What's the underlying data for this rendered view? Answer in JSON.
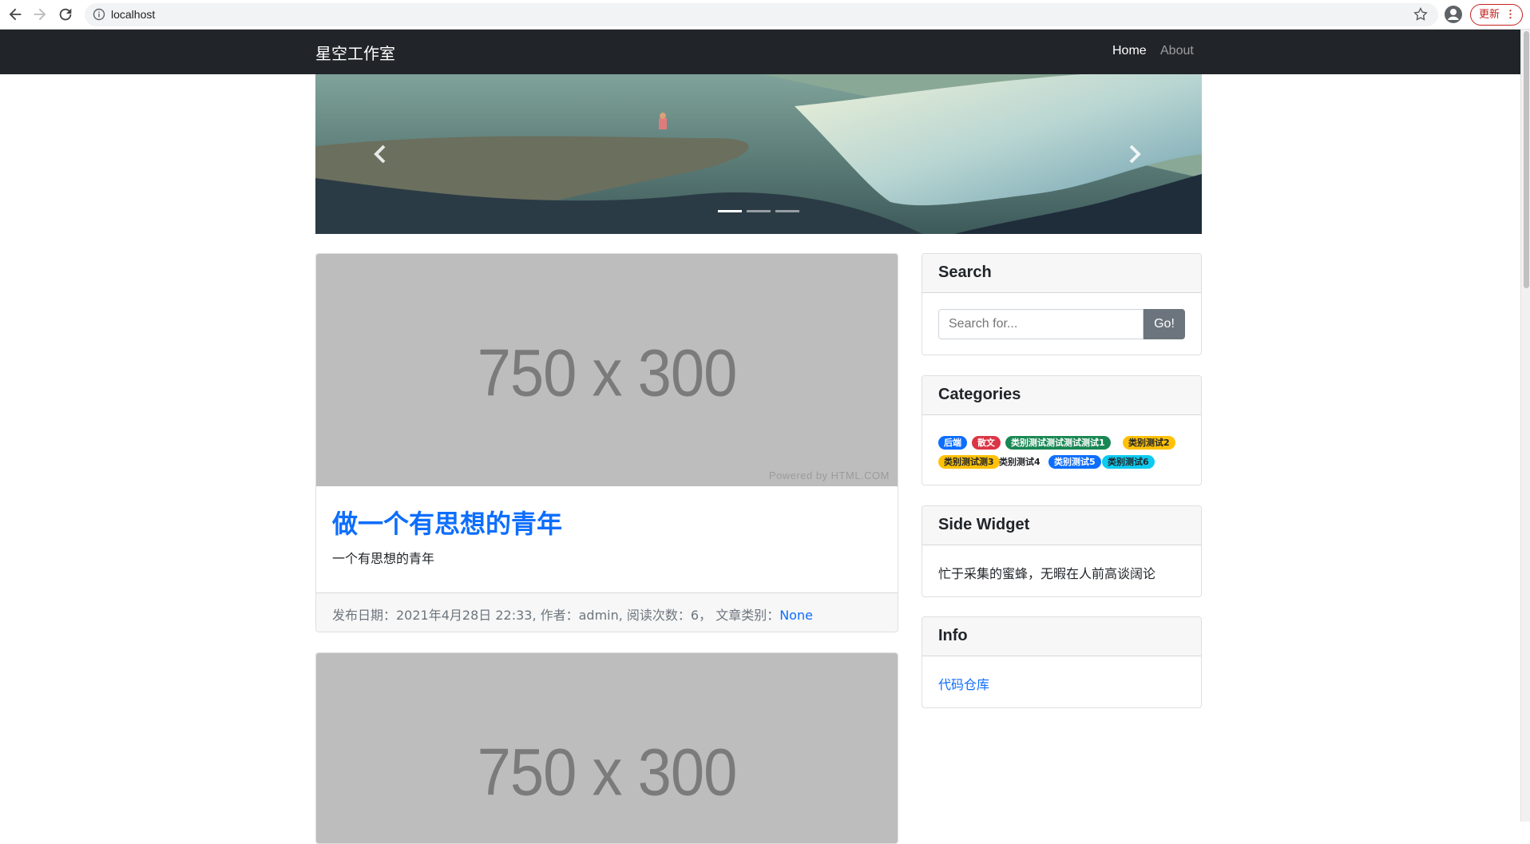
{
  "browser": {
    "url": "localhost",
    "update_label": "更新",
    "menu_dots": "⋮"
  },
  "navbar": {
    "brand": "星空工作室",
    "links": [
      {
        "label": "Home",
        "active": true
      },
      {
        "label": "About",
        "active": false
      }
    ]
  },
  "carousel": {
    "indicators": 3,
    "active_index": 0
  },
  "posts": [
    {
      "image_text": "750 x 300",
      "image_credit": "Powered by HTML.COM",
      "title": "做一个有思想的青年",
      "excerpt": "一个有思想的青年",
      "meta": "发布日期：2021年4月28日 22:33, 作者：admin, 阅读次数：6，  文章类别：",
      "category_link": "None"
    },
    {
      "image_text": "750 x 300",
      "image_credit": "",
      "title": "",
      "excerpt": "",
      "meta": "",
      "category_link": ""
    }
  ],
  "sidebar": {
    "search": {
      "title": "Search",
      "placeholder": "Search for...",
      "button": "Go!"
    },
    "categories": {
      "title": "Categories",
      "badges": [
        {
          "label": "后端",
          "bg": "#0d6efd",
          "color": "#ffffff"
        },
        {
          "label": "散文",
          "bg": "#dc3545",
          "color": "#ffffff"
        },
        {
          "label": "类别测试测试测试测试1",
          "bg": "#198754",
          "color": "#ffffff"
        },
        {
          "label": "类别测试2",
          "bg": "#ffc107",
          "color": "#212529"
        },
        {
          "label": "类别测试测3",
          "bg": "#ffc107",
          "color": "#212529"
        },
        {
          "label": "类别测试4",
          "bg": "transparent",
          "color": "#212529"
        },
        {
          "label": "类别测试5",
          "bg": "#0d6efd",
          "color": "#ffffff"
        },
        {
          "label": "类别测试6",
          "bg": "#0dcaf0",
          "color": "#212529"
        }
      ]
    },
    "side_widget": {
      "title": "Side Widget",
      "text": "忙于采集的蜜蜂，无暇在人前高谈阔论"
    },
    "info": {
      "title": "Info",
      "link": "代码仓库"
    }
  }
}
